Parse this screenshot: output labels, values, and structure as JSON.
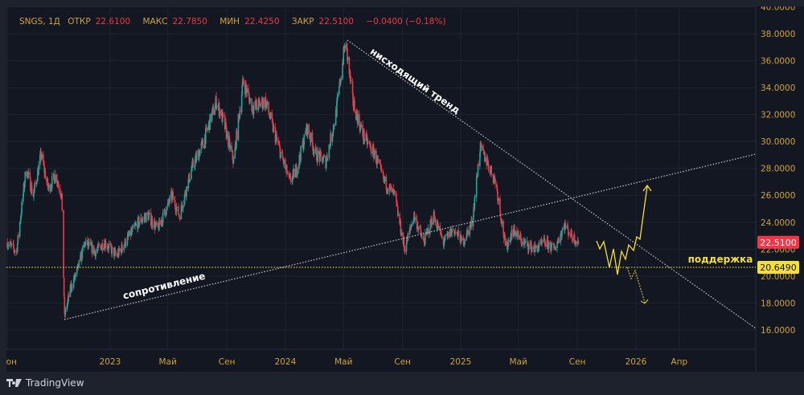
{
  "header": {
    "symbol": "SNGS, 1Д",
    "open_label": "ОТКР",
    "open": "22.6100",
    "high_label": "МАКС",
    "high": "22.7850",
    "low_label": "МИН",
    "low": "22.4250",
    "close_label": "ЗАКР",
    "close": "22.5100",
    "change": "−0.0400 (−0.18%)"
  },
  "footer": {
    "brand": "TradingView"
  },
  "colors": {
    "up": "#26a69a",
    "down": "#f23645",
    "axis_text": "#d1a23a",
    "forecast": "#f5e03a",
    "support": "#d8c83a",
    "trendline": "#c8c8c8",
    "background": "#131722"
  },
  "chart_data": {
    "type": "candlestick",
    "symbol": "SNGS",
    "interval": "1Д",
    "ylim": [
      15,
      40
    ],
    "y_ticks": [
      "16.0000",
      "18.0000",
      "20.0000",
      "22.0000",
      "24.0000",
      "26.0000",
      "28.0000",
      "30.0000",
      "32.0000",
      "34.0000",
      "36.0000",
      "38.0000",
      "40.0000"
    ],
    "x_ticks": [
      {
        "label": "Июн",
        "date": "2022-06-01"
      },
      {
        "label": "2023",
        "date": "2023-01-01"
      },
      {
        "label": "Май",
        "date": "2023-05-01"
      },
      {
        "label": "Сен",
        "date": "2023-09-01"
      },
      {
        "label": "2024",
        "date": "2024-01-01"
      },
      {
        "label": "Май",
        "date": "2024-05-01"
      },
      {
        "label": "Сен",
        "date": "2024-09-01"
      },
      {
        "label": "2025",
        "date": "2025-01-01"
      },
      {
        "label": "Май",
        "date": "2025-05-01"
      },
      {
        "label": "Сен",
        "date": "2025-09-01"
      },
      {
        "label": "2026",
        "date": "2026-01-01"
      },
      {
        "label": "Апр",
        "date": "2026-04-01"
      }
    ],
    "price_path_approx": [
      [
        "2022-06-01",
        22.5
      ],
      [
        "2022-06-20",
        21.8
      ],
      [
        "2022-07-10",
        28.0
      ],
      [
        "2022-07-25",
        26.0
      ],
      [
        "2022-08-10",
        29.0
      ],
      [
        "2022-08-25",
        26.5
      ],
      [
        "2022-09-10",
        27.5
      ],
      [
        "2022-09-22",
        26.0
      ],
      [
        "2022-09-28",
        17.0
      ],
      [
        "2022-10-10",
        19.0
      ],
      [
        "2022-10-25",
        20.5
      ],
      [
        "2022-11-10",
        22.5
      ],
      [
        "2022-12-01",
        21.8
      ],
      [
        "2022-12-20",
        22.5
      ],
      [
        "2023-01-15",
        21.5
      ],
      [
        "2023-02-10",
        23.0
      ],
      [
        "2023-03-01",
        24.0
      ],
      [
        "2023-03-20",
        24.5
      ],
      [
        "2023-04-10",
        23.5
      ],
      [
        "2023-05-10",
        26.0
      ],
      [
        "2023-05-25",
        24.5
      ],
      [
        "2023-06-20",
        28.0
      ],
      [
        "2023-07-15",
        30.0
      ],
      [
        "2023-08-10",
        33.0
      ],
      [
        "2023-08-25",
        31.5
      ],
      [
        "2023-09-15",
        28.5
      ],
      [
        "2023-10-05",
        34.5
      ],
      [
        "2023-10-25",
        32.5
      ],
      [
        "2023-11-20",
        33.0
      ],
      [
        "2023-12-10",
        30.5
      ],
      [
        "2024-01-10",
        27.0
      ],
      [
        "2024-01-25",
        28.0
      ],
      [
        "2024-02-15",
        31.0
      ],
      [
        "2024-03-05",
        29.0
      ],
      [
        "2024-03-25",
        28.5
      ],
      [
        "2024-04-15",
        32.0
      ],
      [
        "2024-05-05",
        37.5
      ],
      [
        "2024-05-20",
        33.0
      ],
      [
        "2024-06-10",
        30.5
      ],
      [
        "2024-07-05",
        29.0
      ],
      [
        "2024-07-25",
        27.0
      ],
      [
        "2024-08-15",
        26.0
      ],
      [
        "2024-09-05",
        22.0
      ],
      [
        "2024-09-25",
        24.5
      ],
      [
        "2024-10-15",
        22.5
      ],
      [
        "2024-11-05",
        24.5
      ],
      [
        "2024-11-25",
        22.5
      ],
      [
        "2024-12-15",
        23.5
      ],
      [
        "2025-01-05",
        22.5
      ],
      [
        "2025-01-25",
        24.0
      ],
      [
        "2025-02-10",
        29.5
      ],
      [
        "2025-02-25",
        28.5
      ],
      [
        "2025-03-15",
        27.0
      ],
      [
        "2025-04-05",
        22.0
      ],
      [
        "2025-04-20",
        23.5
      ],
      [
        "2025-05-10",
        22.5
      ],
      [
        "2025-06-05",
        22.0
      ],
      [
        "2025-06-25",
        22.5
      ],
      [
        "2025-07-15",
        22.0
      ],
      [
        "2025-08-05",
        23.8
      ],
      [
        "2025-08-20",
        23.0
      ],
      [
        "2025-09-03",
        22.51
      ]
    ],
    "horizontal_levels": [
      {
        "price": 20.649,
        "label": "поддержка"
      }
    ],
    "last_price": "22.5100",
    "support_price": "20.6490",
    "annotations": {
      "resistance": "сопротивление",
      "downtrend": "нисходящий тренд",
      "support": "поддержка"
    }
  }
}
